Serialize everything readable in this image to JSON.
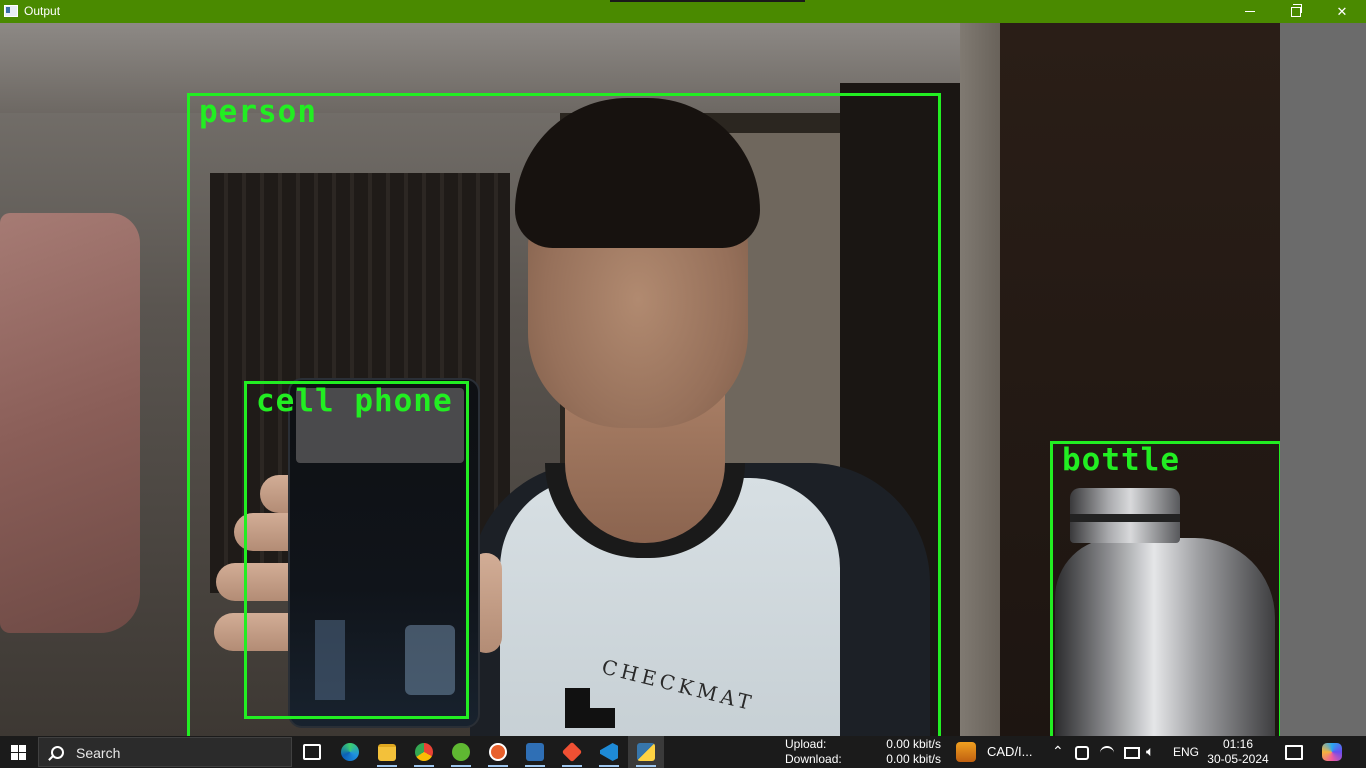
{
  "window": {
    "title": "Output"
  },
  "detections": [
    {
      "label": "person"
    },
    {
      "label": "cell phone"
    },
    {
      "label": "bottle"
    }
  ],
  "shirt_print": "CHECKMAT",
  "colors": {
    "title_bar": "#4a8a00",
    "box_color": "#22ee22",
    "taskbar": "#1b1b1b"
  },
  "taskbar": {
    "search_label": "Search",
    "apps": [
      "task-view-icon",
      "edge-icon",
      "file-explorer-icon",
      "chrome-icon",
      "app-green-icon",
      "app-orange-icon",
      "app-blue-icon",
      "git-icon",
      "vscode-icon",
      "python-window-icon"
    ],
    "upload_label": "Upload:",
    "upload_value": "0.00 kbit/s",
    "download_label": "Download:",
    "download_value": "0.00 kbit/s",
    "cad_label": "CAD/I...",
    "language": "ENG",
    "time": "01:16",
    "date": "30-05-2024"
  }
}
